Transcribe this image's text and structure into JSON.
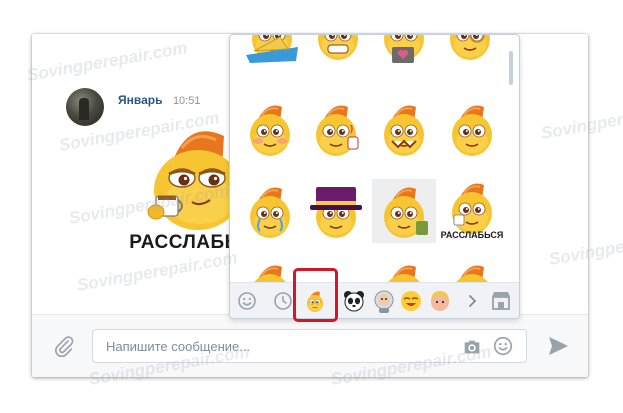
{
  "message": {
    "author": "Январь",
    "time": "10:51",
    "sticker_caption": "РАССЛАБЬСЯ"
  },
  "composer": {
    "placeholder": "Напишите сообщение..."
  },
  "sticker_panel": {
    "sticker_caption": "РАССЛАБЬСЯ",
    "tabs": [
      "smile-tab-icon",
      "recent-tab-icon",
      "sticker-pack-tab",
      "panda-pack-tab",
      "astronaut-pack-tab",
      "emoji-face-pack-tab",
      "blonde-girl-pack-tab",
      "scroll-right-icon",
      "sticker-store-icon"
    ]
  },
  "watermark": {
    "text": "Sovingperepair.com"
  },
  "colors": {
    "sticker_body": "#f7c531",
    "sticker_hat": "#e8761f",
    "highlight": "#d2172a",
    "link": "#2a5885"
  }
}
